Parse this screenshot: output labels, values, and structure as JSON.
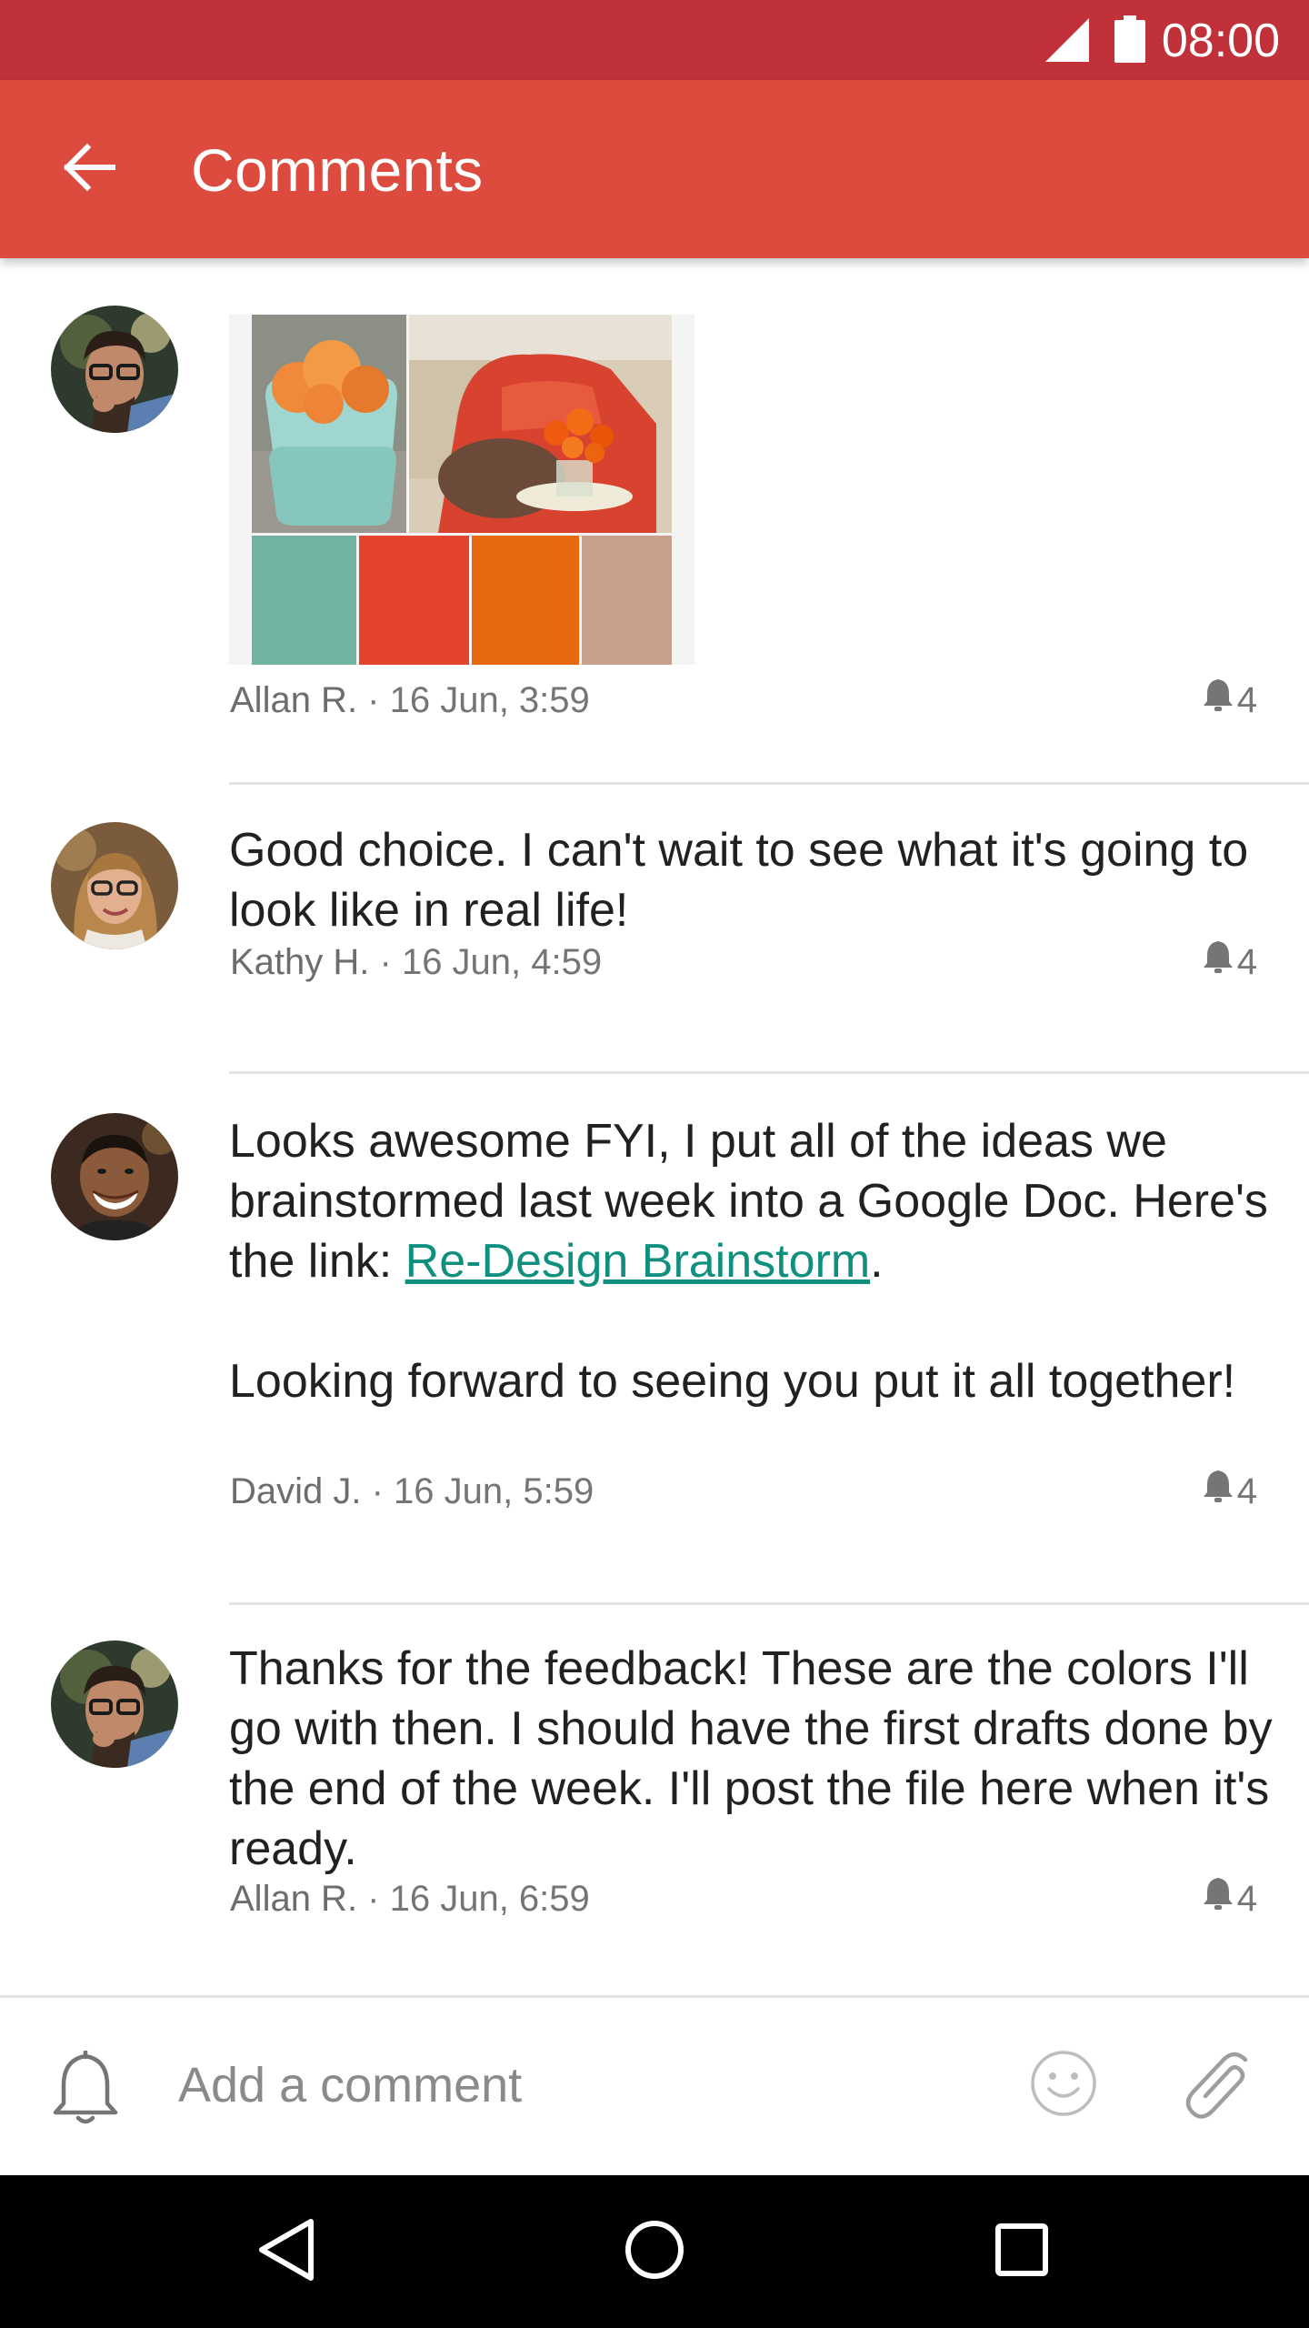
{
  "status_bar": {
    "time": "08:00",
    "signal_icon": "cellular-signal-icon",
    "battery_icon": "battery-full-icon"
  },
  "app_bar": {
    "title": "Comments",
    "back_icon": "arrow-back-icon"
  },
  "comments": [
    {
      "author": "Allan R.",
      "time": "16 Jun, 3:59",
      "notify_count": "4",
      "attachment": {
        "type": "image",
        "palette": [
          "#6fb3a0",
          "#e4432d",
          "#e8680f",
          "#c8a08e"
        ]
      }
    },
    {
      "author": "Kathy H.",
      "time": "16 Jun, 4:59",
      "notify_count": "4",
      "text": "Good choice. I can't wait to see what it's going to look like in real life!"
    },
    {
      "author": "David J.",
      "time": "16 Jun, 5:59",
      "notify_count": "4",
      "text_line1_pre": "Looks awesome FYI, I put all of the ideas we brainstormed last week into a Google Doc. Here's the link: ",
      "link_text": "Re-Design Brainstorm",
      "text_line1_post": ".",
      "text_para2": "Looking forward to seeing you put it all together!"
    },
    {
      "author": "Allan R.",
      "time": "16 Jun, 6:59",
      "notify_count": "4",
      "text": "Thanks for the feedback! These are the colors I'll go with then. I should have the first drafts done by the end of the week. I'll post the file here when it's ready."
    }
  ],
  "meta_separator": " · ",
  "compose": {
    "placeholder": "Add a comment",
    "bell_icon": "notification-bell-icon",
    "emoji_icon": "emoji-icon",
    "attach_icon": "attachment-paperclip-icon"
  },
  "colors": {
    "status_bar": "#c0313a",
    "app_bar": "#dd4b3e",
    "link": "#0f8f7e"
  }
}
